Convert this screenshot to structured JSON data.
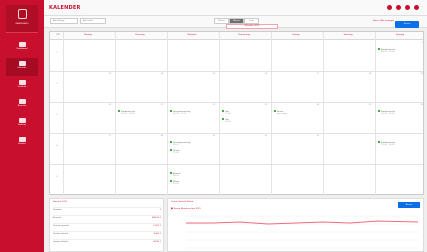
{
  "sidebar": {
    "brand": "WARENHAUS",
    "items": [
      {
        "label": "Dashboard",
        "icon": "dashboard-icon"
      },
      {
        "label": "Kalender",
        "icon": "calendar-icon"
      },
      {
        "label": "Verkäufe",
        "icon": "sales-icon"
      },
      {
        "label": "Besuche",
        "icon": "visits-icon"
      },
      {
        "label": "Auftrag",
        "icon": "order-icon"
      },
      {
        "label": "Kunden",
        "icon": "customers-icon"
      }
    ]
  },
  "topbar": {
    "title": "KALENDER",
    "dropdown_a": "Alle Kollege",
    "dropdown_b": "Alle Läufe",
    "views": [
      "Monat",
      "Woche",
      "Liste"
    ],
    "date_select": "Kalender 2019",
    "link": "Hinzu / Alle anzeigen",
    "action": "Neuen"
  },
  "calendar": {
    "week_header": "KW",
    "days": [
      "Montag",
      "Dienstag",
      "Mittwoch",
      "Donnerstag",
      "Freitag",
      "Samstag",
      "Sonntag"
    ],
    "weeks": [
      {
        "wk": "1",
        "dates": [
          "",
          "",
          "",
          "",
          "",
          "",
          "2"
        ]
      },
      {
        "wk": "2",
        "dates": [
          "13",
          "14",
          "15",
          "16",
          "17",
          "18",
          "19"
        ]
      },
      {
        "wk": "3",
        "dates": [
          "20",
          "21",
          "22",
          "23",
          "24",
          "25",
          "26"
        ]
      },
      {
        "wk": "4",
        "dates": [
          "27",
          "28",
          "29",
          "30",
          "31",
          "",
          ""
        ]
      },
      {
        "wk": "5",
        "dates": [
          "",
          "",
          "",
          "",
          "",
          "",
          ""
        ]
      }
    ],
    "events": [
      {
        "text": "Kundentermin",
        "sub": "08:00 - 10:00",
        "day": 6,
        "week": 0,
        "offset": 0
      },
      {
        "text": "Kundentermin",
        "sub": "10:00 - 12:00",
        "day": 1,
        "week": 2,
        "offset": 0
      },
      {
        "text": "Vertriebsmeeting",
        "sub": "09:00 - 11:00",
        "day": 2,
        "week": 2,
        "offset": 0
      },
      {
        "text": "Test",
        "sub": "13:00",
        "day": 3,
        "week": 2,
        "offset": 0
      },
      {
        "text": "Test",
        "sub": "14:00",
        "day": 3,
        "week": 2,
        "offset": 8
      },
      {
        "text": "Messe",
        "sub": "ganztägig",
        "day": 4,
        "week": 2,
        "offset": 0
      },
      {
        "text": "Kundentermin",
        "sub": "15:00 - 16:00",
        "day": 6,
        "week": 2,
        "offset": 0
      },
      {
        "text": "Vertriebsmeeting",
        "sub": "09:00",
        "day": 2,
        "week": 3,
        "offset": 0
      },
      {
        "text": "Termin",
        "sub": "11:00",
        "day": 2,
        "week": 3,
        "offset": 8
      },
      {
        "text": "Kundentermin",
        "sub": "13:00 - 14:00",
        "day": 6,
        "week": 3,
        "offset": 0
      },
      {
        "text": "Besuch",
        "sub": "08:00",
        "day": 2,
        "week": 4,
        "offset": 0
      },
      {
        "text": "Messe",
        "sub": "10:00",
        "day": 2,
        "week": 4,
        "offset": 8
      }
    ]
  },
  "stats": {
    "title": "Statistik 2019",
    "rows": [
      {
        "k": "Umsätze",
        "v": "0"
      },
      {
        "k": "Besuche",
        "v": "482,63 €"
      },
      {
        "k": "Termine gesamt",
        "v": "2.093 €"
      },
      {
        "k": "Umsatz aktuell",
        "v": "3.000 €"
      },
      {
        "k": "Umsatz Vorjahr",
        "v": "4.183 €"
      }
    ]
  },
  "chart": {
    "title": "Termin Statistik Monat",
    "legend": "■ Termin Monatsverlauf 2019",
    "button": "Neuen"
  },
  "colors": {
    "brand": "#c8102e",
    "accent": "#0b6fe8",
    "event": "#3db33d"
  }
}
